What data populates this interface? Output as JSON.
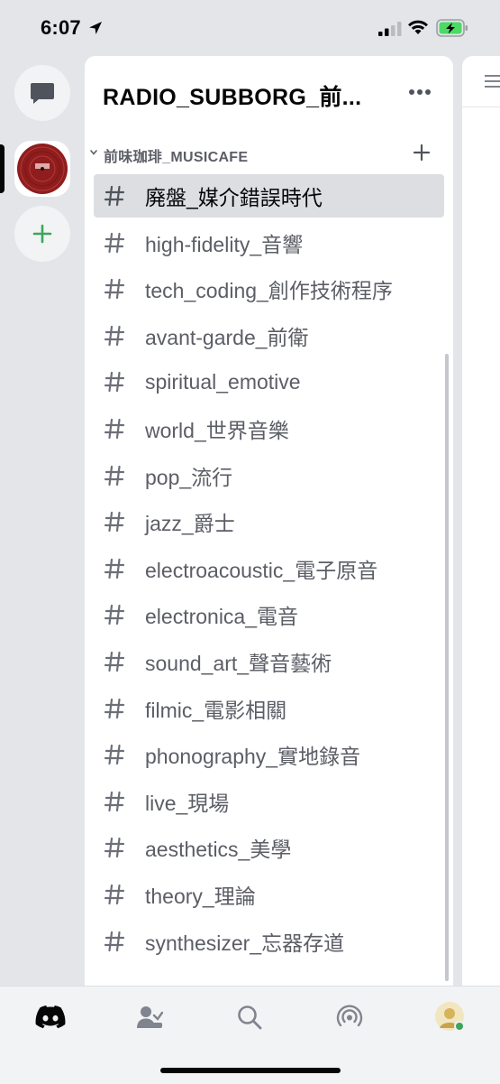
{
  "status_bar": {
    "time": "6:07"
  },
  "server": {
    "name": "RADIO_SUBBORG_前...",
    "category": "前味珈琲_MUSICAFE",
    "channels": [
      {
        "label": "廃盤_媒介錯誤時代",
        "selected": true
      },
      {
        "label": "high-fidelity_音響"
      },
      {
        "label": "tech_coding_創作技術程序"
      },
      {
        "label": "avant-garde_前衛"
      },
      {
        "label": "spiritual_emotive"
      },
      {
        "label": "world_世界音樂"
      },
      {
        "label": "pop_流行"
      },
      {
        "label": "jazz_爵士"
      },
      {
        "label": "electroacoustic_電子原音"
      },
      {
        "label": "electronica_電音"
      },
      {
        "label": "sound_art_聲音藝術"
      },
      {
        "label": "filmic_電影相關"
      },
      {
        "label": "phonography_實地錄音"
      },
      {
        "label": "live_現場"
      },
      {
        "label": "aesthetics_美學"
      },
      {
        "label": "theory_理論"
      },
      {
        "label": "synthesizer_忘器存道"
      }
    ]
  },
  "tabs": [
    {
      "icon": "discord-home-icon"
    },
    {
      "icon": "friends-icon"
    },
    {
      "icon": "search-icon"
    },
    {
      "icon": "mentions-icon"
    },
    {
      "icon": "profile-avatar"
    }
  ],
  "colors": {
    "background": "#e3e5e8",
    "panel": "#ffffff",
    "selected": "#dcdee2",
    "muted_text": "#5c5e66",
    "green": "#3ba55d",
    "server_red": "#a82a2a"
  }
}
